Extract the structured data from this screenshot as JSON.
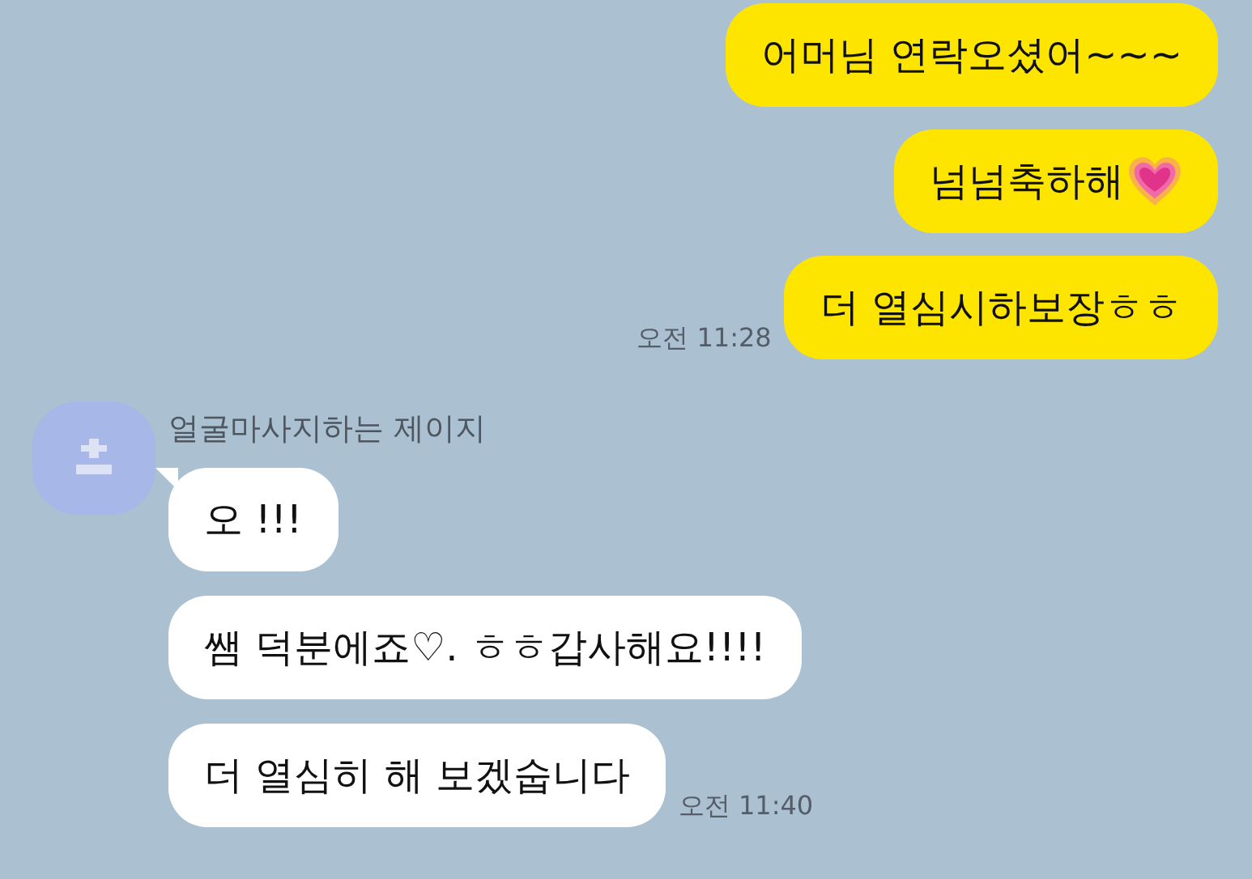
{
  "outgoing": {
    "messages": [
      {
        "text": "어머님 연락오셨어~~~",
        "kind": "text"
      },
      {
        "text": "넘넘축하해",
        "kind": "heart"
      },
      {
        "text": "더 열심시하보장ㅎㅎ",
        "kind": "text"
      }
    ],
    "time": "오전 11:28"
  },
  "incoming": {
    "sender": "얼굴마사지하는 제이지",
    "messages": [
      {
        "text": "오 !!!"
      },
      {
        "text": "쌤 덕분에죠♡. ㅎㅎ갑사해요!!!!"
      },
      {
        "text": "더 열심히 해 보겠숩니다"
      }
    ],
    "time": "오전 11:40"
  }
}
